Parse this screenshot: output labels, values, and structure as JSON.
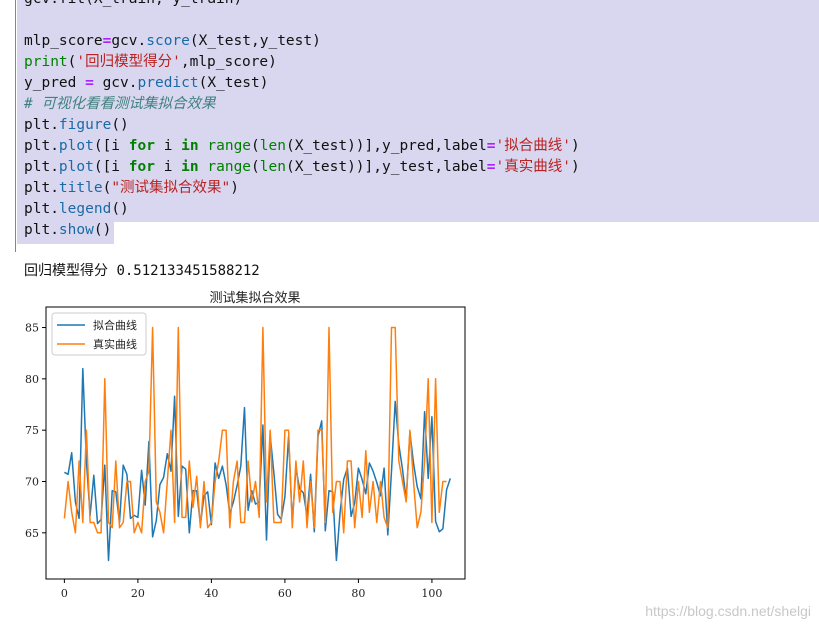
{
  "code_lines": [
    "gcv.fit(X_train, y_train)",
    "",
    "mlp_score=gcv.score(X_test,y_test)",
    "print('回归模型得分',mlp_score)",
    "y_pred = gcv.predict(X_test)",
    "# 可视化看看测试集拟合效果",
    "plt.figure()",
    "plt.plot([i for i in range(len(X_test))],y_pred,label='拟合曲线')",
    "plt.plot([i for i in range(len(X_test))],y_test,label='真实曲线')",
    "plt.title(\"测试集拟合效果\")",
    "plt.legend()",
    "plt.show()"
  ],
  "output": {
    "label": "回归模型得分",
    "value": "0.512133451588212"
  },
  "watermark": "https://blog.csdn.net/shelgi",
  "colors": {
    "pred": "#1f77b4",
    "test": "#ff7f0e",
    "code_bg": "#d9d7ef",
    "cell_border": "#4f93c9"
  },
  "chart_data": {
    "type": "line",
    "title": "测试集拟合效果",
    "xlim": [
      -5,
      109
    ],
    "ylim": [
      60.5,
      87
    ],
    "xticks": [
      0,
      20,
      40,
      60,
      80,
      100
    ],
    "yticks": [
      65,
      70,
      75,
      80,
      85
    ],
    "legend_position": "top-left",
    "grid": false,
    "series": [
      {
        "name": "拟合曲线",
        "color": "#1f77b4",
        "values": [
          70.9,
          70.7,
          72.8,
          68.0,
          66.4,
          81.0,
          72.0,
          66.7,
          70.6,
          65.9,
          66.3,
          71.6,
          62.3,
          69.1,
          69.0,
          66.0,
          71.6,
          70.7,
          66.4,
          66.7,
          66.5,
          71.1,
          67.7,
          73.9,
          64.6,
          66.2,
          69.7,
          70.4,
          72.7,
          71.0,
          78.3,
          66.6,
          71.5,
          71.2,
          65.0,
          69.1,
          69.1,
          65.8,
          68.6,
          69.0,
          65.8,
          71.8,
          70.3,
          71.5,
          69.7,
          66.9,
          68.0,
          69.6,
          71.5,
          77.2,
          67.2,
          69.1,
          67.8,
          68.0,
          75.5,
          64.3,
          74.5,
          70.8,
          66.8,
          66.3,
          68.5,
          74.4,
          66.0,
          71.3,
          69.3,
          68.9,
          66.7,
          70.7,
          65.1,
          74.4,
          75.9,
          65.2,
          69.1,
          69.0,
          62.3,
          66.9,
          70.2,
          71.3,
          66.6,
          67.9,
          71.3,
          70.2,
          68.8,
          71.8,
          71.0,
          69.9,
          68.6,
          71.3,
          64.8,
          71.0,
          77.8,
          73.6,
          71.2,
          68.2,
          74.8,
          71.8,
          69.5,
          68.3,
          76.8,
          70.3,
          76.3,
          66.1,
          65.1,
          65.4,
          69.2,
          70.3
        ]
      },
      {
        "name": "真实曲线",
        "color": "#ff7f0e",
        "values": [
          66.4,
          70.0,
          67.0,
          65.0,
          72.0,
          66.0,
          75.0,
          66.0,
          66.0,
          65.0,
          65.0,
          80.0,
          66.0,
          65.5,
          72.0,
          65.5,
          66.0,
          70.0,
          70.0,
          65.0,
          66.0,
          65.0,
          70.0,
          71.0,
          85.0,
          68.0,
          67.0,
          65.0,
          70.0,
          75.0,
          66.0,
          85.0,
          66.5,
          66.5,
          72.0,
          67.5,
          70.5,
          65.5,
          70.0,
          65.5,
          66.0,
          70.0,
          72.0,
          75.0,
          75.0,
          65.5,
          70.0,
          72.0,
          66.0,
          66.0,
          72.0,
          68.0,
          70.0,
          66.5,
          85.0,
          68.0,
          75.0,
          66.0,
          66.0,
          66.0,
          75.0,
          75.0,
          65.5,
          72.0,
          68.0,
          72.0,
          65.5,
          70.0,
          65.5,
          75.0,
          75.0,
          66.0,
          85.0,
          67.0,
          70.0,
          70.0,
          65.0,
          72.0,
          72.0,
          65.5,
          70.0,
          66.5,
          73.0,
          67.0,
          70.0,
          66.0,
          70.0,
          66.5,
          65.5,
          85.0,
          85.0,
          72.0,
          70.0,
          68.0,
          75.0,
          70.0,
          65.5,
          67.0,
          72.0,
          80.0,
          66.0,
          80.0,
          67.0,
          70.0,
          70.0
        ]
      }
    ]
  }
}
